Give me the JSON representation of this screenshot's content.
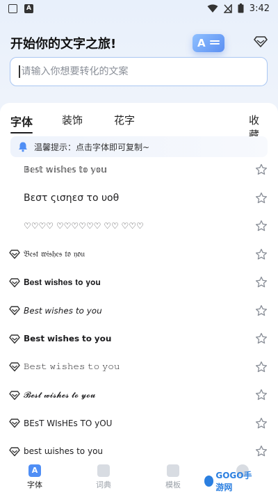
{
  "status_bar": {
    "time": "3:42"
  },
  "header": {
    "title": "开始你的文字之旅!",
    "hero_letter": "A"
  },
  "search": {
    "placeholder": "请输入你想要转化的文案",
    "value": ""
  },
  "tabs": [
    {
      "label": "字体",
      "active": true
    },
    {
      "label": "装饰",
      "active": false
    },
    {
      "label": "花字",
      "active": false
    },
    {
      "label": "收藏",
      "active": false
    }
  ],
  "notice": {
    "text": "温馨提示：点击字体即可复制~"
  },
  "font_rows": [
    {
      "text": "𝔹𝕖𝕤𝕥 𝕨𝕚𝕤𝕙𝕖𝕤 𝕥𝕠 𝕪𝕠𝕦",
      "premium": false
    },
    {
      "text": "Βεστ ςισηεσ το υοθ",
      "premium": false
    },
    {
      "text": "♡♡♡♡ ♡♡♡♡♡♡ ♡♡ ♡♡♡",
      "premium": false
    },
    {
      "text": "𝔅𝔢𝔰𝔱 𝔴𝔦𝔰𝔥𝔢𝔰 𝔱𝔬 𝔶𝔬𝔲",
      "premium": true
    },
    {
      "text": "𝐁𝐞𝐬𝐭 𝐰𝐢𝐬𝐡𝐞𝐬 𝐭𝐨 𝐲𝐨𝐮",
      "premium": true
    },
    {
      "text": "𝘉𝘦𝘴𝘵 𝘸𝘪𝘴𝘩𝘦𝘴 𝘵𝘰 𝘺𝘰𝘶",
      "premium": true
    },
    {
      "text": "𝗕𝗲𝘀𝘁 𝘄𝗶𝘀𝗵𝗲𝘀 𝘁𝗼 𝘆𝗼𝘂",
      "premium": true
    },
    {
      "text": "𝙱𝚎𝚜𝚝 𝚠𝚒𝚜𝚑𝚎𝚜 𝚝𝚘 𝚢𝚘𝚞",
      "premium": true
    },
    {
      "text": "𝓑𝓮𝓼𝓽 𝔀𝓲𝓼𝓱𝓮𝓼 𝓽𝓸 𝔂𝓸𝓾",
      "premium": true
    },
    {
      "text": "BEsT WIsHEs TO yOU",
      "premium": true
    },
    {
      "text": "best ɯishes to you",
      "premium": true
    }
  ],
  "bottom_nav": [
    {
      "label": "字体",
      "active": true
    },
    {
      "label": "词典",
      "active": false
    },
    {
      "label": "模板",
      "active": false
    },
    {
      "label": "我的",
      "active": false
    }
  ],
  "watermark": {
    "text": "GOGO手游网"
  },
  "colors": {
    "accent": "#5b8ff2",
    "search_border": "#a9c6f2",
    "icon_gray": "#8a8f98"
  }
}
